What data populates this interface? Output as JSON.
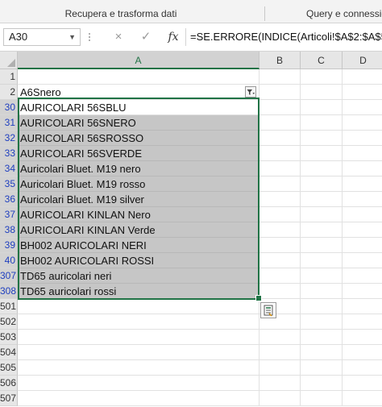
{
  "ribbon": {
    "groups": [
      "Recupera e trasforma dati",
      "Query e connessio"
    ]
  },
  "formula_bar": {
    "name_box": "A30",
    "cancel_icon": "×",
    "enter_icon": "✓",
    "fx_label": "fx",
    "formula": "=SE.ERRORE(INDICE(Articoli!$A$2:$A$5"
  },
  "columns": [
    "A",
    "B",
    "C",
    "D"
  ],
  "rows": [
    {
      "num": "1",
      "a": ""
    },
    {
      "num": "2",
      "a": "A6Snero"
    },
    {
      "num": "30",
      "a": "AURICOLARI 56SBLU"
    },
    {
      "num": "31",
      "a": "AURICOLARI 56SNERO"
    },
    {
      "num": "32",
      "a": "AURICOLARI 56SROSSO"
    },
    {
      "num": "33",
      "a": "AURICOLARI 56SVERDE"
    },
    {
      "num": "34",
      "a": "Auricolari Bluet. M19 nero"
    },
    {
      "num": "35",
      "a": "Auricolari Bluet. M19 rosso"
    },
    {
      "num": "36",
      "a": "Auricolari Bluet. M19 silver"
    },
    {
      "num": "37",
      "a": "AURICOLARI KINLAN Nero"
    },
    {
      "num": "38",
      "a": "AURICOLARI KINLAN Verde"
    },
    {
      "num": "39",
      "a": "BH002 AURICOLARI NERI"
    },
    {
      "num": "40",
      "a": "BH002 AURICOLARI ROSSI"
    },
    {
      "num": "307",
      "a": "TD65 auricolari neri"
    },
    {
      "num": "308",
      "a": "TD65 auricolari rossi"
    },
    {
      "num": "501",
      "a": ""
    },
    {
      "num": "502",
      "a": ""
    },
    {
      "num": "503",
      "a": ""
    },
    {
      "num": "504",
      "a": ""
    },
    {
      "num": "505",
      "a": ""
    },
    {
      "num": "506",
      "a": ""
    },
    {
      "num": "507",
      "a": ""
    }
  ],
  "icons": {
    "filter": "filter-active-icon",
    "quick_analysis": "quick-analysis-icon"
  },
  "colors": {
    "selection": "#217346",
    "filtered_row_number": "#1f3fbf",
    "selected_fill": "#c6c6c6"
  }
}
